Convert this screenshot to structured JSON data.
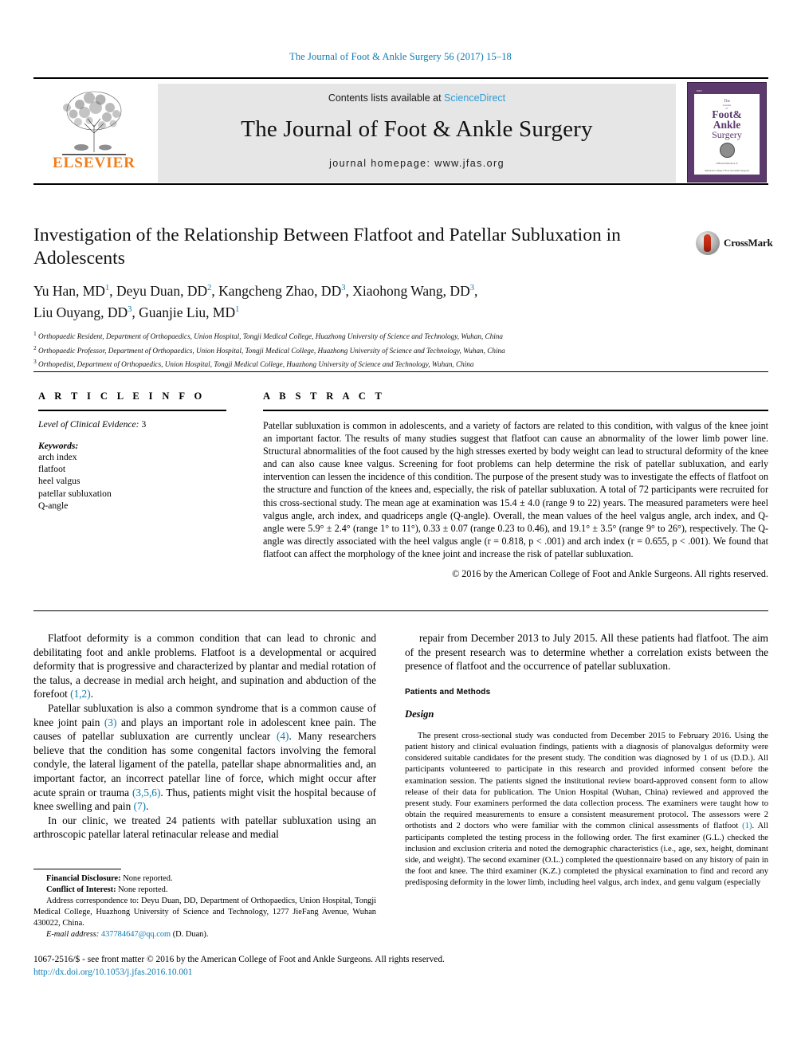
{
  "running_head": "The Journal of Foot & Ankle Surgery 56 (2017) 15–18",
  "masthead": {
    "publisher": "ELSEVIER",
    "contents_prefix": "Contents lists available at ",
    "contents_link": "ScienceDirect",
    "journal_name": "The Journal of Foot & Ankle Surgery",
    "homepage": "journal homepage: www.jfas.org",
    "cover": {
      "tag": "ISSN",
      "line_the": "The",
      "line_journal": "Journal",
      "line_of": "of",
      "line_foot": "Foot&",
      "line_ankle": "Ankle",
      "line_surgery": "Surgery",
      "footer1": "Official Publication of",
      "footer2": "PUBLISHED BY THE",
      "footer3": "American College of Foot and Ankle Surgeons"
    }
  },
  "article": {
    "title": "Investigation of the Relationship Between Flatfoot and Patellar Subluxation in Adolescents",
    "crossmark_label": "CrossMark",
    "authors_line1_a": "Yu Han, MD",
    "authors_sup1": "1",
    "authors_line1_b": ", Deyu Duan, DD",
    "authors_sup2": "2",
    "authors_line1_c": ", Kangcheng Zhao, DD",
    "authors_sup3": "3",
    "authors_line1_d": ", Xiaohong Wang, DD",
    "authors_sup4": "3",
    "authors_line1_e": ",",
    "authors_line2_a": "Liu Ouyang, DD",
    "authors_sup5": "3",
    "authors_line2_b": ", Guanjie Liu, MD",
    "authors_sup6": "1",
    "affiliations": [
      {
        "sup": "1",
        "text": "Orthopaedic Resident, Department of Orthopaedics, Union Hospital, Tongji Medical College, Huazhong University of Science and Technology, Wuhan, China"
      },
      {
        "sup": "2",
        "text": "Orthopaedic Professor, Department of Orthopaedics, Union Hospital, Tongji Medical College, Huazhong University of Science and Technology, Wuhan, China"
      },
      {
        "sup": "3",
        "text": "Orthopedist, Department of Orthopaedics, Union Hospital, Tongji Medical College, Huazhong University of Science and Technology, Wuhan, China"
      }
    ]
  },
  "article_info": {
    "heading": "A R T I C L E  I N F O",
    "level_of_evidence_label": "Level of Clinical Evidence:",
    "level_of_evidence_value": "3",
    "keywords_label": "Keywords:",
    "keywords": [
      "arch index",
      "flatfoot",
      "heel valgus",
      "patellar subluxation",
      "Q-angle"
    ]
  },
  "abstract": {
    "heading": "A B S T R A C T",
    "text": "Patellar subluxation is common in adolescents, and a variety of factors are related to this condition, with valgus of the knee joint an important factor. The results of many studies suggest that flatfoot can cause an abnormality of the lower limb power line. Structural abnormalities of the foot caused by the high stresses exerted by body weight can lead to structural deformity of the knee and can also cause knee valgus. Screening for foot problems can help determine the risk of patellar subluxation, and early intervention can lessen the incidence of this condition. The purpose of the present study was to investigate the effects of flatfoot on the structure and function of the knees and, especially, the risk of patellar subluxation. A total of 72 participants were recruited for this cross-sectional study. The mean age at examination was 15.4 ± 4.0 (range 9 to 22) years. The measured parameters were heel valgus angle, arch index, and quadriceps angle (Q-angle). Overall, the mean values of the heel valgus angle, arch index, and Q-angle were 5.9° ± 2.4° (range 1° to 11°), 0.33 ± 0.07 (range 0.23 to 0.46), and 19.1° ± 3.5° (range 9° to 26°), respectively. The Q-angle was directly associated with the heel valgus angle (r = 0.818, p < .001) and arch index (r = 0.655, p < .001). We found that flatfoot can affect the morphology of the knee joint and increase the risk of patellar subluxation.",
    "copyright": "© 2016 by the American College of Foot and Ankle Surgeons. All rights reserved."
  },
  "body": {
    "left": [
      {
        "parts": [
          {
            "t": "Flatfoot deformity is a common condition that can lead to chronic and debilitating foot and ankle problems. Flatfoot is a developmental or acquired deformity that is progressive and characterized by plantar and medial rotation of the talus, a decrease in medial arch height, and supination and abduction of the forefoot ",
            "ref": false
          },
          {
            "t": "(1,2)",
            "ref": true
          },
          {
            "t": ".",
            "ref": false
          }
        ]
      },
      {
        "parts": [
          {
            "t": "Patellar subluxation is also a common syndrome that is a common cause of knee joint pain ",
            "ref": false
          },
          {
            "t": "(3)",
            "ref": true
          },
          {
            "t": " and plays an important role in adolescent knee pain. The causes of patellar subluxation are currently unclear ",
            "ref": false
          },
          {
            "t": "(4)",
            "ref": true
          },
          {
            "t": ". Many researchers believe that the condition has some congenital factors involving the femoral condyle, the lateral ligament of the patella, patellar shape abnormalities and, an important factor, an incorrect patellar line of force, which might occur after acute sprain or trauma ",
            "ref": false
          },
          {
            "t": "(3,5,6)",
            "ref": true
          },
          {
            "t": ". Thus, patients might visit the hospital because of knee swelling and pain ",
            "ref": false
          },
          {
            "t": "(7)",
            "ref": true
          },
          {
            "t": ".",
            "ref": false
          }
        ]
      },
      {
        "parts": [
          {
            "t": "In our clinic, we treated 24 patients with patellar subluxation using an arthroscopic patellar lateral retinacular release and medial",
            "ref": false
          }
        ]
      }
    ],
    "right_top": "repair from December 2013 to July 2015. All these patients had flatfoot. The aim of the present research was to determine whether a correlation exists between the presence of flatfoot and the occurrence of patellar subluxation.",
    "section_heading": "Patients and Methods",
    "subsection_heading": "Design",
    "design_parts": [
      {
        "t": "The present cross-sectional study was conducted from December 2015 to February 2016. Using the patient history and clinical evaluation findings, patients with a diagnosis of planovalgus deformity were considered suitable candidates for the present study. The condition was diagnosed by 1 of us (D.D.). All participants volunteered to participate in this research and provided informed consent before the examination session. The patients signed the institutional review board-approved consent form to allow release of their data for publication. The Union Hospital (Wuhan, China) reviewed and approved the present study. Four examiners performed the data collection process. The examiners were taught how to obtain the required measurements to ensure a consistent measurement protocol. The assessors were 2 orthotists and 2 doctors who were familiar with the common clinical assessments of flatfoot ",
        "ref": false
      },
      {
        "t": "(1)",
        "ref": true
      },
      {
        "t": ". All participants completed the testing process in the following order. The first examiner (G.L.) checked the inclusion and exclusion criteria and noted the demographic characteristics (i.e., age, sex, height, dominant side, and weight). The second examiner (O.L.) completed the questionnaire based on any history of pain in the foot and knee. The third examiner (K.Z.) completed the physical examination to find and record any predisposing deformity in the lower limb, including heel valgus, arch index, and genu valgum (especially",
        "ref": false
      }
    ]
  },
  "footnotes": {
    "financial_label": "Financial Disclosure:",
    "financial_value": " None reported.",
    "conflict_label": "Conflict of Interest:",
    "conflict_value": " None reported.",
    "address": "Address correspondence to: Deyu Duan, DD, Department of Orthopaedics, Union Hospital, Tongji Medical College, Huazhong University of Science and Technology, 1277 JieFang Avenue, Wuhan 430022, China.",
    "email_label": "E-mail address:",
    "email": "437784647@qq.com",
    "email_suffix": " (D. Duan)."
  },
  "page_footer": {
    "issn_line": "1067-2516/$ - see front matter © 2016 by the American College of Foot and Ankle Surgeons. All rights reserved.",
    "doi": "http://dx.doi.org/10.1053/j.jfas.2016.10.001"
  }
}
